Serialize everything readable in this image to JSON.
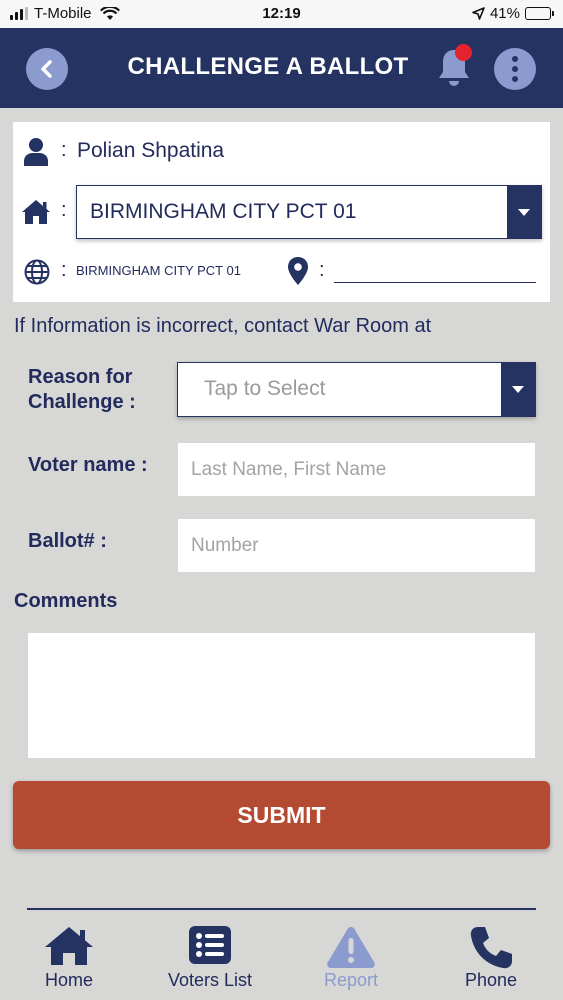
{
  "status_bar": {
    "carrier": "T-Mobile",
    "time": "12:19",
    "battery": "41%",
    "battery_level": 0.41
  },
  "header": {
    "title": "CHALLENGE A BALLOT"
  },
  "info": {
    "name": "Polian Shpatina",
    "precinct": "BIRMINGHAM CITY PCT 01",
    "city": "BIRMINGHAM CITY PCT 01",
    "location": ""
  },
  "notice": "If Information is incorrect, contact War Room at",
  "form": {
    "reason_label_line1": "Reason for",
    "reason_label_line2": "Challenge :",
    "reason_placeholder": "Tap to Select",
    "voter_name_label": "Voter name :",
    "voter_name_placeholder": "Last Name, First Name",
    "ballot_label": "Ballot# :",
    "ballot_placeholder": "Number",
    "comments_label": "Comments",
    "comments_value": ""
  },
  "submit_label": "SUBMIT",
  "tabs": [
    {
      "label": "Home",
      "icon": "home-icon"
    },
    {
      "label": "Voters List",
      "icon": "list-icon"
    },
    {
      "label": "Report",
      "icon": "warning-icon"
    },
    {
      "label": "Phone",
      "icon": "phone-icon"
    }
  ],
  "colors": {
    "header": "#253363",
    "accent_light": "#8c9bcf",
    "submit": "#b44a32",
    "notification": "#e5232f",
    "background": "#d7d7d5"
  }
}
